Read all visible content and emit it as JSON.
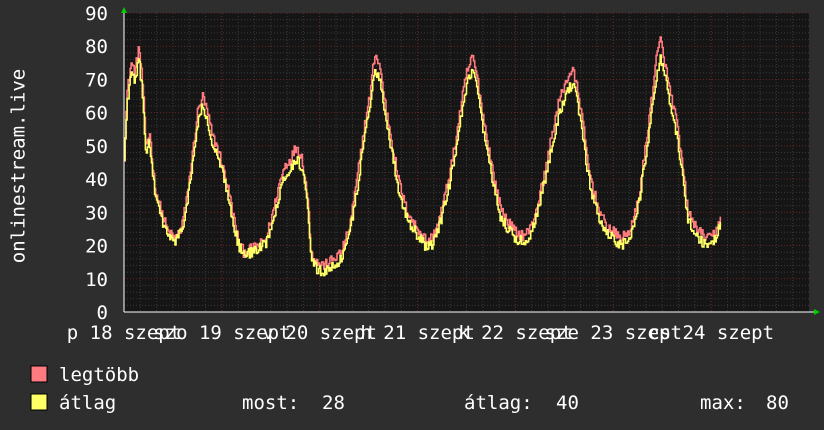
{
  "chart_data": {
    "type": "line",
    "ylabel": "onlinestream.live",
    "ylim": [
      0,
      90
    ],
    "yticks": [
      "0",
      "10",
      "20",
      "30",
      "40",
      "50",
      "60",
      "70",
      "80",
      "90"
    ],
    "xlim": [
      0,
      7
    ],
    "xticks": [
      {
        "pos": 0,
        "label": "p 18 szept"
      },
      {
        "pos": 1,
        "label": "szo 19 szept"
      },
      {
        "pos": 2,
        "label": "v 20 szept"
      },
      {
        "pos": 3,
        "label": "h 21 szept"
      },
      {
        "pos": 4,
        "label": "k 22 szept"
      },
      {
        "pos": 5,
        "label": "sze 23 szept"
      },
      {
        "pos": 6,
        "label": "cs 24 szept"
      }
    ],
    "grid": true,
    "colors": {
      "background": "#2e2e2e",
      "plot": "#151515",
      "grid_minor": "#3a3a3a",
      "grid_major": "#6b2424",
      "axis": "#ffffff",
      "arrow": "#00cc00"
    },
    "series": [
      {
        "name": "legtöbb",
        "color": "#ff7b80",
        "anchors": [
          [
            0,
            47
          ],
          [
            0.03,
            66
          ],
          [
            0.07,
            75
          ],
          [
            0.11,
            72
          ],
          [
            0.15,
            80
          ],
          [
            0.19,
            68
          ],
          [
            0.22,
            50
          ],
          [
            0.26,
            54
          ],
          [
            0.31,
            38
          ],
          [
            0.38,
            30
          ],
          [
            0.45,
            24
          ],
          [
            0.52,
            22
          ],
          [
            0.58,
            25
          ],
          [
            0.64,
            34
          ],
          [
            0.7,
            48
          ],
          [
            0.75,
            60
          ],
          [
            0.8,
            65
          ],
          [
            0.85,
            60
          ],
          [
            0.9,
            53
          ],
          [
            0.96,
            49
          ],
          [
            1.02,
            42
          ],
          [
            1.07,
            36
          ],
          [
            1.12,
            28
          ],
          [
            1.17,
            21
          ],
          [
            1.22,
            18
          ],
          [
            1.3,
            19
          ],
          [
            1.38,
            20
          ],
          [
            1.45,
            22
          ],
          [
            1.52,
            30
          ],
          [
            1.58,
            38
          ],
          [
            1.64,
            44
          ],
          [
            1.7,
            46
          ],
          [
            1.76,
            50
          ],
          [
            1.81,
            47
          ],
          [
            1.85,
            40
          ],
          [
            1.88,
            32
          ],
          [
            1.91,
            18
          ],
          [
            1.96,
            15
          ],
          [
            2.05,
            14
          ],
          [
            2.14,
            16
          ],
          [
            2.22,
            18
          ],
          [
            2.3,
            25
          ],
          [
            2.38,
            40
          ],
          [
            2.45,
            55
          ],
          [
            2.51,
            65
          ],
          [
            2.56,
            78
          ],
          [
            2.61,
            74
          ],
          [
            2.67,
            62
          ],
          [
            2.73,
            52
          ],
          [
            2.8,
            40
          ],
          [
            2.87,
            32
          ],
          [
            2.95,
            27
          ],
          [
            3.03,
            24
          ],
          [
            3.1,
            21
          ],
          [
            3.16,
            23
          ],
          [
            3.22,
            28
          ],
          [
            3.3,
            38
          ],
          [
            3.38,
            50
          ],
          [
            3.44,
            62
          ],
          [
            3.5,
            72
          ],
          [
            3.56,
            77
          ],
          [
            3.61,
            70
          ],
          [
            3.66,
            60
          ],
          [
            3.72,
            50
          ],
          [
            3.78,
            40
          ],
          [
            3.84,
            32
          ],
          [
            3.92,
            27
          ],
          [
            4.0,
            24
          ],
          [
            4.08,
            23
          ],
          [
            4.15,
            25
          ],
          [
            4.22,
            32
          ],
          [
            4.3,
            42
          ],
          [
            4.38,
            55
          ],
          [
            4.45,
            64
          ],
          [
            4.52,
            70
          ],
          [
            4.58,
            73
          ],
          [
            4.64,
            66
          ],
          [
            4.69,
            56
          ],
          [
            4.74,
            44
          ],
          [
            4.8,
            36
          ],
          [
            4.86,
            30
          ],
          [
            4.92,
            26
          ],
          [
            5.0,
            24
          ],
          [
            5.08,
            22
          ],
          [
            5.15,
            24
          ],
          [
            5.2,
            27
          ],
          [
            5.26,
            35
          ],
          [
            5.32,
            48
          ],
          [
            5.38,
            62
          ],
          [
            5.43,
            75
          ],
          [
            5.48,
            82
          ],
          [
            5.53,
            74
          ],
          [
            5.58,
            66
          ],
          [
            5.64,
            58
          ],
          [
            5.7,
            45
          ],
          [
            5.76,
            30
          ],
          [
            5.83,
            26
          ],
          [
            5.91,
            23
          ],
          [
            5.98,
            22
          ],
          [
            6.04,
            24
          ],
          [
            6.1,
            29
          ]
        ],
        "values_summary": {
          "now": "28",
          "average": "40",
          "max": "80"
        }
      },
      {
        "name": "átlag",
        "color": "#ffff66",
        "anchors": [
          [
            0,
            46
          ],
          [
            0.03,
            63
          ],
          [
            0.07,
            72
          ],
          [
            0.11,
            69
          ],
          [
            0.15,
            76
          ],
          [
            0.19,
            65
          ],
          [
            0.22,
            48
          ],
          [
            0.26,
            51
          ],
          [
            0.31,
            36
          ],
          [
            0.38,
            28
          ],
          [
            0.45,
            23
          ],
          [
            0.52,
            21
          ],
          [
            0.58,
            24
          ],
          [
            0.64,
            32
          ],
          [
            0.7,
            45
          ],
          [
            0.75,
            57
          ],
          [
            0.8,
            62
          ],
          [
            0.85,
            57
          ],
          [
            0.9,
            50
          ],
          [
            0.96,
            46
          ],
          [
            1.02,
            40
          ],
          [
            1.07,
            34
          ],
          [
            1.12,
            26
          ],
          [
            1.17,
            20
          ],
          [
            1.22,
            17
          ],
          [
            1.3,
            18
          ],
          [
            1.38,
            19
          ],
          [
            1.45,
            21
          ],
          [
            1.52,
            28
          ],
          [
            1.58,
            35
          ],
          [
            1.64,
            41
          ],
          [
            1.7,
            43
          ],
          [
            1.76,
            46
          ],
          [
            1.81,
            44
          ],
          [
            1.85,
            37
          ],
          [
            1.88,
            29
          ],
          [
            1.91,
            16
          ],
          [
            1.96,
            13
          ],
          [
            2.05,
            12
          ],
          [
            2.14,
            14
          ],
          [
            2.22,
            16
          ],
          [
            2.3,
            23
          ],
          [
            2.38,
            37
          ],
          [
            2.45,
            52
          ],
          [
            2.51,
            62
          ],
          [
            2.56,
            74
          ],
          [
            2.61,
            70
          ],
          [
            2.67,
            59
          ],
          [
            2.73,
            49
          ],
          [
            2.8,
            37
          ],
          [
            2.87,
            30
          ],
          [
            2.95,
            25
          ],
          [
            3.03,
            22
          ],
          [
            3.1,
            19
          ],
          [
            3.16,
            21
          ],
          [
            3.22,
            26
          ],
          [
            3.3,
            35
          ],
          [
            3.38,
            47
          ],
          [
            3.44,
            58
          ],
          [
            3.5,
            68
          ],
          [
            3.56,
            73
          ],
          [
            3.61,
            66
          ],
          [
            3.66,
            56
          ],
          [
            3.72,
            46
          ],
          [
            3.78,
            37
          ],
          [
            3.84,
            29
          ],
          [
            3.92,
            25
          ],
          [
            4.0,
            22
          ],
          [
            4.08,
            21
          ],
          [
            4.15,
            23
          ],
          [
            4.22,
            30
          ],
          [
            4.3,
            40
          ],
          [
            4.38,
            52
          ],
          [
            4.45,
            60
          ],
          [
            4.52,
            66
          ],
          [
            4.58,
            69
          ],
          [
            4.64,
            62
          ],
          [
            4.69,
            52
          ],
          [
            4.74,
            41
          ],
          [
            4.8,
            33
          ],
          [
            4.86,
            28
          ],
          [
            4.92,
            24
          ],
          [
            5.0,
            22
          ],
          [
            5.08,
            20
          ],
          [
            5.15,
            22
          ],
          [
            5.2,
            25
          ],
          [
            5.26,
            33
          ],
          [
            5.32,
            45
          ],
          [
            5.38,
            58
          ],
          [
            5.43,
            70
          ],
          [
            5.48,
            77
          ],
          [
            5.53,
            70
          ],
          [
            5.58,
            62
          ],
          [
            5.64,
            54
          ],
          [
            5.7,
            42
          ],
          [
            5.76,
            28
          ],
          [
            5.83,
            24
          ],
          [
            5.91,
            21
          ],
          [
            5.98,
            20
          ],
          [
            6.04,
            22
          ],
          [
            6.1,
            27
          ]
        ]
      }
    ],
    "legend": {
      "placement": "bottom-left",
      "items": [
        {
          "label": "legtöbb",
          "color": "#ff7b80"
        },
        {
          "label": "átlag",
          "color": "#ffff66"
        }
      ],
      "stats": {
        "now_label": "most:",
        "now_value": "28",
        "avg_label": "átlag:",
        "avg_value": "40",
        "max_label": "max:",
        "max_value": "80"
      }
    }
  }
}
